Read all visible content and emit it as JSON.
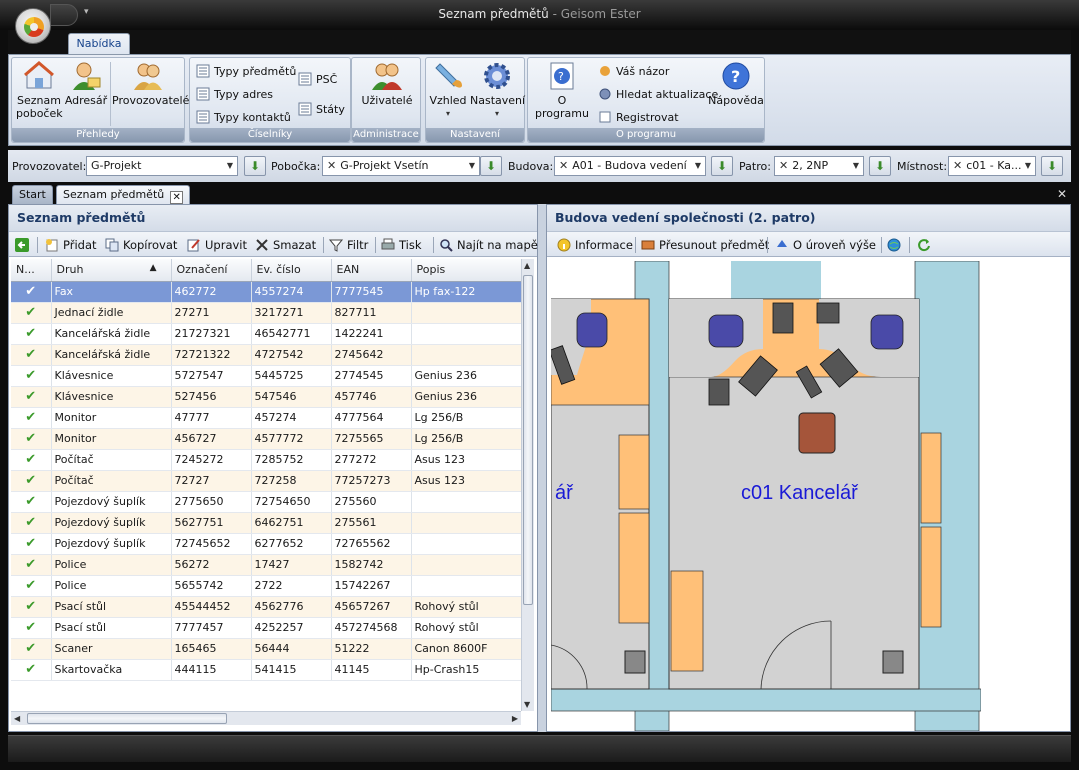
{
  "window": {
    "title": "Seznam předmětů",
    "app_name": " - Geisom Ester"
  },
  "ribbon": {
    "tab": "Nabídka",
    "groups": [
      {
        "title": "Přehledy"
      },
      {
        "title": "Číselníky"
      },
      {
        "title": "Administrace"
      },
      {
        "title": "Nastavení"
      },
      {
        "title": "O programu"
      }
    ],
    "seznam_pobocek": "Seznam",
    "seznam_pobocek_2": "poboček",
    "adresar": "Adresář",
    "provozovatele": "Provozovatelé",
    "typy_predmetu": "Typy předmětů",
    "typy_adres": "Typy adres",
    "typy_kontaktu": "Typy kontaktů",
    "psc": "PSČ",
    "staty": "Státy",
    "uzivatele": "Uživatelé",
    "vzhled": "Vzhled",
    "nastaveni": "Nastavení",
    "o_programu": "O programu",
    "vas_nazor": "Váš názor",
    "hledat_aktualizace": "Hledat aktualizace",
    "registrovat": "Registrovat",
    "napoveda": "Nápověda"
  },
  "filters": {
    "provozovatel_label": "Provozovatel:",
    "provozovatel_value": "G-Projekt",
    "pobocka_label": "Pobočka:",
    "pobocka_value": "G-Projekt Vsetín",
    "budova_label": "Budova:",
    "budova_value": "A01 - Budova vedení ...",
    "patro_label": "Patro:",
    "patro_value": "2, 2NP",
    "mistnost_label": "Místnost:",
    "mistnost_value": "c01 - Ka..."
  },
  "doc_tabs": [
    {
      "label": "Start"
    },
    {
      "label": "Seznam předmětů"
    }
  ],
  "left_panel": {
    "title": "Seznam předmětů",
    "toolbar": {
      "pridat": "Přidat",
      "kopirovat": "Kopírovat",
      "upravit": "Upravit",
      "smazat": "Smazat",
      "filtr": "Filtr",
      "tisk": "Tisk",
      "najit": "Najít na mapě"
    },
    "columns": [
      "N...",
      "Druh",
      "Označení",
      "Ev. číslo",
      "EAN",
      "Popis"
    ],
    "rows": [
      [
        "Fax",
        "462772",
        "4557274",
        "7777545",
        "Hp fax-122"
      ],
      [
        "Jednací židle",
        "27271",
        "3217271",
        "827711",
        ""
      ],
      [
        "Kancelářská židle",
        "21727321",
        "46542771",
        "1422241",
        ""
      ],
      [
        "Kancelářská židle",
        "72721322",
        "4727542",
        "2745642",
        ""
      ],
      [
        "Klávesnice",
        "5727547",
        "5445725",
        "2774545",
        "Genius 236"
      ],
      [
        "Klávesnice",
        "527456",
        "547546",
        "457746",
        "Genius 236"
      ],
      [
        "Monitor",
        "47777",
        "457274",
        "4777564",
        "Lg 256/B"
      ],
      [
        "Monitor",
        "456727",
        "4577772",
        "7275565",
        "Lg 256/B"
      ],
      [
        "Počítač",
        "7245272",
        "7285752",
        "277272",
        "Asus 123"
      ],
      [
        "Počítač",
        "72727",
        "727258",
        "77257273",
        "Asus 123"
      ],
      [
        "Pojezdový šuplík",
        "2775650",
        "72754650",
        "275560",
        ""
      ],
      [
        "Pojezdový šuplík",
        "5627751",
        "6462751",
        "275561",
        ""
      ],
      [
        "Pojezdový šuplík",
        "72745652",
        "6277652",
        "72765562",
        ""
      ],
      [
        "Police",
        "56272",
        "17427",
        "1582742",
        ""
      ],
      [
        "Police",
        "5655742",
        "2722",
        "15742267",
        ""
      ],
      [
        "Psací stůl",
        "45544452",
        "4562776",
        "45657267",
        "Rohový stůl"
      ],
      [
        "Psací stůl",
        "7777457",
        "4252257",
        "457274568",
        "Rohový stůl"
      ],
      [
        "Scaner",
        "165465",
        "56444",
        "51222",
        "Canon 8600F"
      ],
      [
        "Skartovačka",
        "444115",
        "541415",
        "41145",
        "Hp-Crash15"
      ]
    ]
  },
  "right_panel": {
    "title": "Budova vedení společnosti (2. patro)",
    "toolbar": {
      "informace": "Informace",
      "presunout": "Přesunout předmět",
      "uroven": "O úroveň výše"
    },
    "room_label": "c01 Kancelář",
    "left_room_label": "ář"
  }
}
